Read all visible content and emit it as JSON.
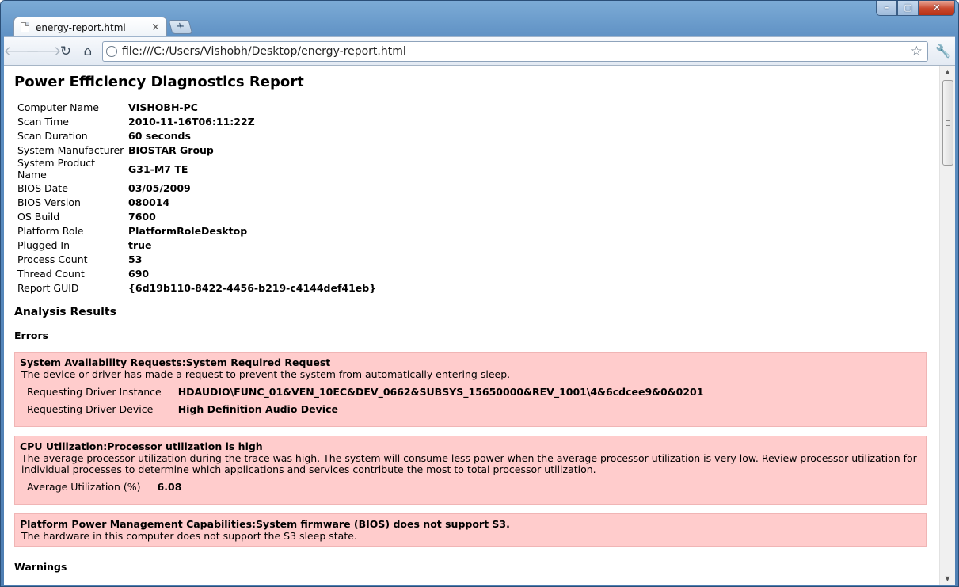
{
  "browser": {
    "tab_title": "energy-report.html",
    "tab_close": "×",
    "new_tab": "+",
    "url": "file:///C:/Users/Vishobh/Desktop/energy-report.html",
    "window_min": "–",
    "window_max": "▢",
    "window_close": "✕"
  },
  "report": {
    "title": "Power Efficiency Diagnostics Report",
    "info": [
      {
        "key": "Computer Name",
        "value": "VISHOBH-PC"
      },
      {
        "key": "Scan Time",
        "value": "2010-11-16T06:11:22Z"
      },
      {
        "key": "Scan Duration",
        "value": "60 seconds"
      },
      {
        "key": "System Manufacturer",
        "value": "BIOSTAR Group"
      },
      {
        "key": "System Product Name",
        "value": "G31-M7 TE"
      },
      {
        "key": "BIOS Date",
        "value": "03/05/2009"
      },
      {
        "key": "BIOS Version",
        "value": "080014"
      },
      {
        "key": "OS Build",
        "value": "7600"
      },
      {
        "key": "Platform Role",
        "value": "PlatformRoleDesktop"
      },
      {
        "key": "Plugged In",
        "value": "true"
      },
      {
        "key": "Process Count",
        "value": "53"
      },
      {
        "key": "Thread Count",
        "value": "690"
      },
      {
        "key": "Report GUID",
        "value": "{6d19b110-8422-4456-b219-c4144def41eb}"
      }
    ],
    "analysis_heading": "Analysis Results",
    "errors_heading": "Errors",
    "errors": [
      {
        "title": "System Availability Requests:System Required Request",
        "description": "The device or driver has made a request to prevent the system from automatically entering sleep.",
        "details": [
          {
            "key": "Requesting Driver Instance",
            "value": "HDAUDIO\\FUNC_01&VEN_10EC&DEV_0662&SUBSYS_15650000&REV_1001\\4&6cdcee9&0&0201"
          },
          {
            "key": "Requesting Driver Device",
            "value": "High Definition Audio Device"
          }
        ]
      },
      {
        "title": "CPU Utilization:Processor utilization is high",
        "description": "The average processor utilization during the trace was high. The system will consume less power when the average processor utilization is very low. Review processor utilization for individual processes to determine which applications and services contribute the most to total processor utilization.",
        "details": [
          {
            "key": "Average Utilization (%)",
            "value": "6.08"
          }
        ]
      },
      {
        "title": "Platform Power Management Capabilities:System firmware (BIOS) does not support S3.",
        "description": "The hardware in this computer does not support the S3 sleep state.",
        "details": []
      }
    ],
    "warnings_heading": "Warnings"
  }
}
